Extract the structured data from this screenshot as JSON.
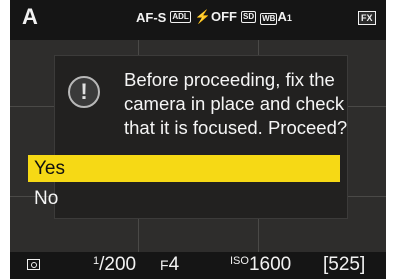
{
  "top": {
    "mode": "A",
    "af_mode": "AF-S",
    "metering_badge": "ADL",
    "flash": "OFF",
    "picture_control": "SD",
    "wb": "WB",
    "wb_value": "A",
    "wb_sub": "1",
    "image_area": "FX"
  },
  "dialog": {
    "icon": "exclamation-icon",
    "message": "Before proceeding, fix the camera in place and check that it is focused. Proceed?",
    "options": [
      {
        "label": "Yes",
        "selected": true
      },
      {
        "label": "No",
        "selected": false
      }
    ],
    "highlight_color": "#f6d915"
  },
  "bottom": {
    "metering_icon": "matrix-metering-icon",
    "shutter_num": "1",
    "shutter_den": "200",
    "aperture_prefix": "F",
    "aperture": "4",
    "iso_label": "ISO",
    "iso": "1600",
    "shots_remaining": "[525]"
  }
}
